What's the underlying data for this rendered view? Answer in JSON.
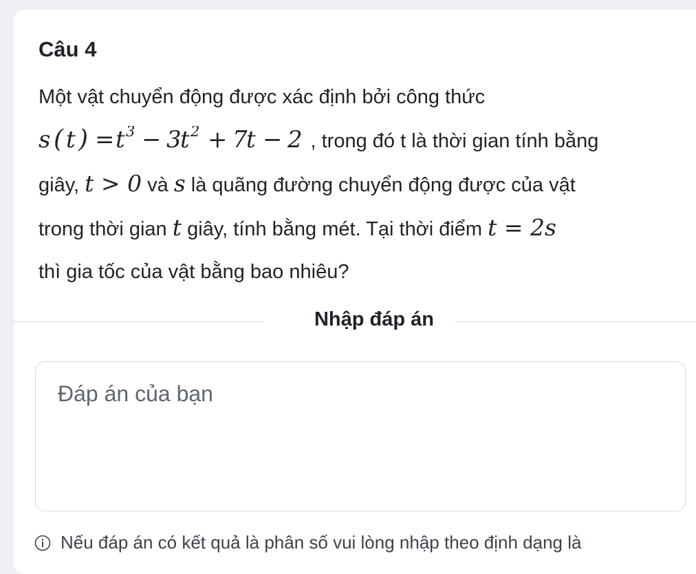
{
  "question": {
    "title": "Câu 4",
    "line1": "Một vật chuyển động được xác định bởi công thức",
    "line2": {
      "formula": "s(t) = t³ − 3t² + 7t − 2",
      "text": ", trong đó t là thời gian tính bằng"
    },
    "line3": {
      "text_a": "giây, ",
      "math_a": "t > 0",
      "text_b": " và ",
      "math_b": "s",
      "text_c": " là quãng đường chuyển động được của vật"
    },
    "line4": {
      "text_a": "trong thời gian ",
      "math_a": "t",
      "text_b": " giây, tính bằng mét. Tại thời điểm ",
      "math_b": "t = 2s"
    },
    "line5": "thì gia tốc của vật bằng bao nhiêu?"
  },
  "answer_section": {
    "label": "Nhập đáp án",
    "placeholder": "Đáp án của bạn",
    "value": ""
  },
  "hint": {
    "icon": "info-icon",
    "text": "Nếu đáp án có kết quả là phân số vui lòng nhập theo định dạng là"
  },
  "colors": {
    "background": "#eef0f4",
    "card": "#ffffff",
    "text": "#1f2328",
    "muted": "#5f6670",
    "border": "#d5d8dd"
  }
}
